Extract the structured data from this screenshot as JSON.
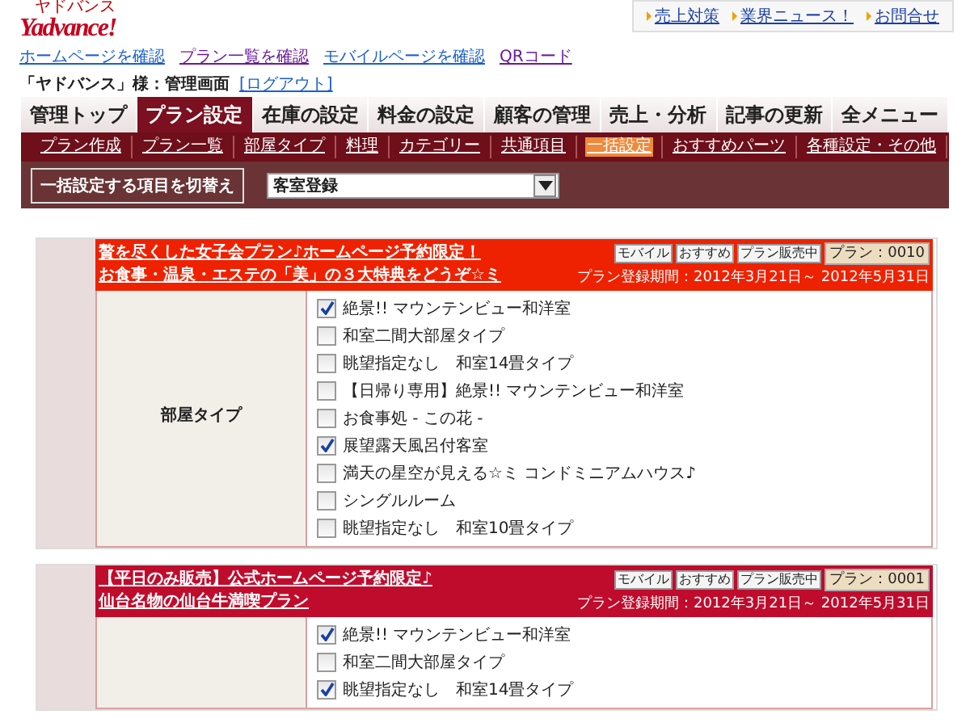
{
  "logo": {
    "text": "Yadvance!",
    "ruby": "ヤドバンス"
  },
  "top_links": [
    "売上対策",
    "業界ニュース！",
    "お問合せ"
  ],
  "site_links": [
    "ホームページを確認",
    "プラン一覧を確認",
    "モバイルページを確認",
    "QRコード"
  ],
  "account": {
    "title": "「ヤドバンス」様：管理画面",
    "logout": "[ログアウト]"
  },
  "tabs": [
    {
      "label": "管理トップ",
      "selected": false
    },
    {
      "label": "プラン設定",
      "selected": true
    },
    {
      "label": "在庫の設定",
      "selected": false
    },
    {
      "label": "料金の設定",
      "selected": false
    },
    {
      "label": "顧客の管理",
      "selected": false
    },
    {
      "label": "売上・分析",
      "selected": false
    },
    {
      "label": "記事の更新",
      "selected": false
    },
    {
      "label": "全メニュー",
      "selected": false
    }
  ],
  "subnav": [
    {
      "label": "プラン作成",
      "selected": false
    },
    {
      "label": "プラン一覧",
      "selected": false
    },
    {
      "label": "部屋タイプ",
      "selected": false
    },
    {
      "label": "料理",
      "selected": false
    },
    {
      "label": "カテゴリー",
      "selected": false
    },
    {
      "label": "共通項目",
      "selected": false
    },
    {
      "label": "一括設定",
      "selected": true
    },
    {
      "label": "おすすめパーツ",
      "selected": false
    },
    {
      "label": "各種設定・その他",
      "selected": false
    }
  ],
  "toolbar": {
    "button": "一括設定する項目を切替え",
    "select_value": "客室登録"
  },
  "plans": [
    {
      "color": "#ee2200",
      "title_lines": [
        "贅を尽くした女子会プラン♪ホームページ予約限定！",
        "お食事・温泉・エステの「美」の３大特典をどうぞ☆ミ"
      ],
      "badges": [
        "モバイル",
        "おすすめ",
        "プラン販売中"
      ],
      "plan_no": "プラン：0010",
      "period": "プラン登録期間：2012年3月21日～ 2012年5月31日",
      "field_label": "部屋タイプ",
      "rooms": [
        {
          "label": "絶景!! マウンテンビュー和洋室",
          "checked": true
        },
        {
          "label": "和室二間大部屋タイプ",
          "checked": false
        },
        {
          "label": "眺望指定なし　和室14畳タイプ",
          "checked": false
        },
        {
          "label": "【日帰り専用】絶景!! マウンテンビュー和洋室",
          "checked": false
        },
        {
          "label": "お食事処 - この花 -",
          "checked": false
        },
        {
          "label": "展望露天風呂付客室",
          "checked": true
        },
        {
          "label": "満天の星空が見える☆ミ コンドミニアムハウス♪",
          "checked": false
        },
        {
          "label": "シングルルーム",
          "checked": false
        },
        {
          "label": "眺望指定なし　和室10畳タイプ",
          "checked": false
        }
      ]
    },
    {
      "color": "#c00c2c",
      "title_lines": [
        "【平日のみ販売】公式ホームページ予約限定♪",
        "仙台名物の仙台牛満喫プラン"
      ],
      "badges": [
        "モバイル",
        "おすすめ",
        "プラン販売中"
      ],
      "plan_no": "プラン：0001",
      "period": "プラン登録期間：2012年3月21日～ 2012年5月31日",
      "rooms": [
        {
          "label": "絶景!! マウンテンビュー和洋室",
          "checked": true
        },
        {
          "label": "和室二間大部屋タイプ",
          "checked": false
        },
        {
          "label": "眺望指定なし　和室14畳タイプ",
          "checked": true
        }
      ]
    }
  ]
}
